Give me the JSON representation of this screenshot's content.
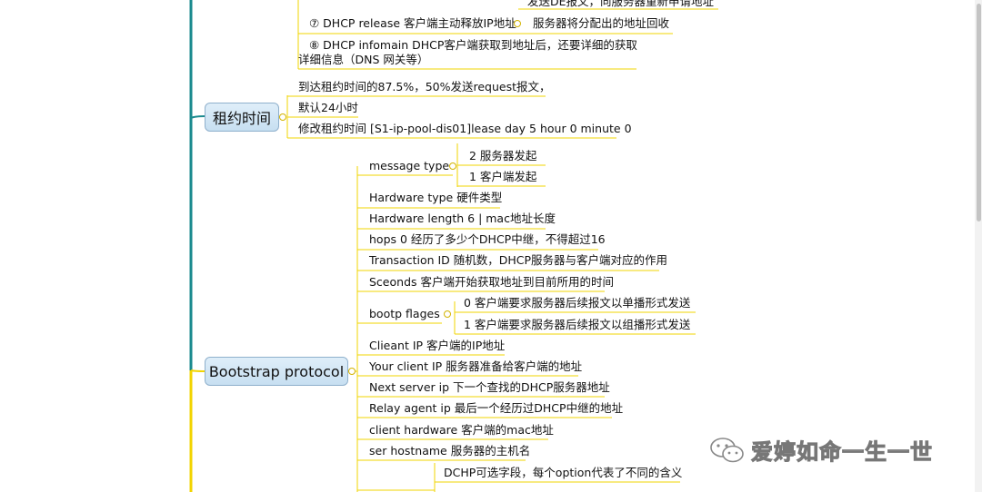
{
  "colors": {
    "spine_teal": "#1a8a8e",
    "spine_yellow": "#f2d400",
    "underline": "#f2d400",
    "topic_fill": "#d6e8f6"
  },
  "top_items": [
    "发送DE报文，向服务器重新申请地址",
    "⑦ DHCP release 客户端主动释放IP地址",
    "服务器将分配出的地址回收",
    "⑧  DHCP infomain  DHCP客户端获取到地址后，还要详细的获取",
    "详细信息（DNS 网关等）"
  ],
  "lease": {
    "title": "租约时间",
    "items": [
      "到达租约时间的87.5%，50%发送request报文，",
      "默认24小时",
      "修改租约时间 [S1-ip-pool-dis01]lease day 5 hour 0 minute 0"
    ]
  },
  "bootstrap": {
    "title": "Bootstrap protocol",
    "message_type": {
      "label": "message type",
      "children": [
        "2  服务器发起",
        "1  客户端发起"
      ]
    },
    "fields_a": [
      "Hardware type  硬件类型",
      "Hardware length 6 | mac地址长度",
      "hops 0 经历了多少个DHCP中继，不得超过16",
      "Transaction ID  随机数，DHCP服务器与客户端对应的作用",
      "Sceonds 客户端开始获取地址到目前所用的时间"
    ],
    "bootp_flags": {
      "label": "bootp flages",
      "children": [
        "0    客户端要求服务器后续报文以单播形式发送",
        "1    客户端要求服务器后续报文以组播形式发送"
      ]
    },
    "fields_b": [
      "Clieant IP  客户端的IP地址",
      "Your client IP 服务器准备给客户端的地址",
      "Next server ip  下一个查找的DHCP服务器地址",
      "Relay agent ip 最后一个经历过DHCP中继的地址",
      "client hardware  客户端的mac地址",
      "ser hostname  服务器的主机名"
    ],
    "option_note": "DCHP可选字段，每个option代表了不同的含义"
  },
  "watermark": {
    "text": "爱婷如命一生一世",
    "icon": "wechat-icon"
  }
}
